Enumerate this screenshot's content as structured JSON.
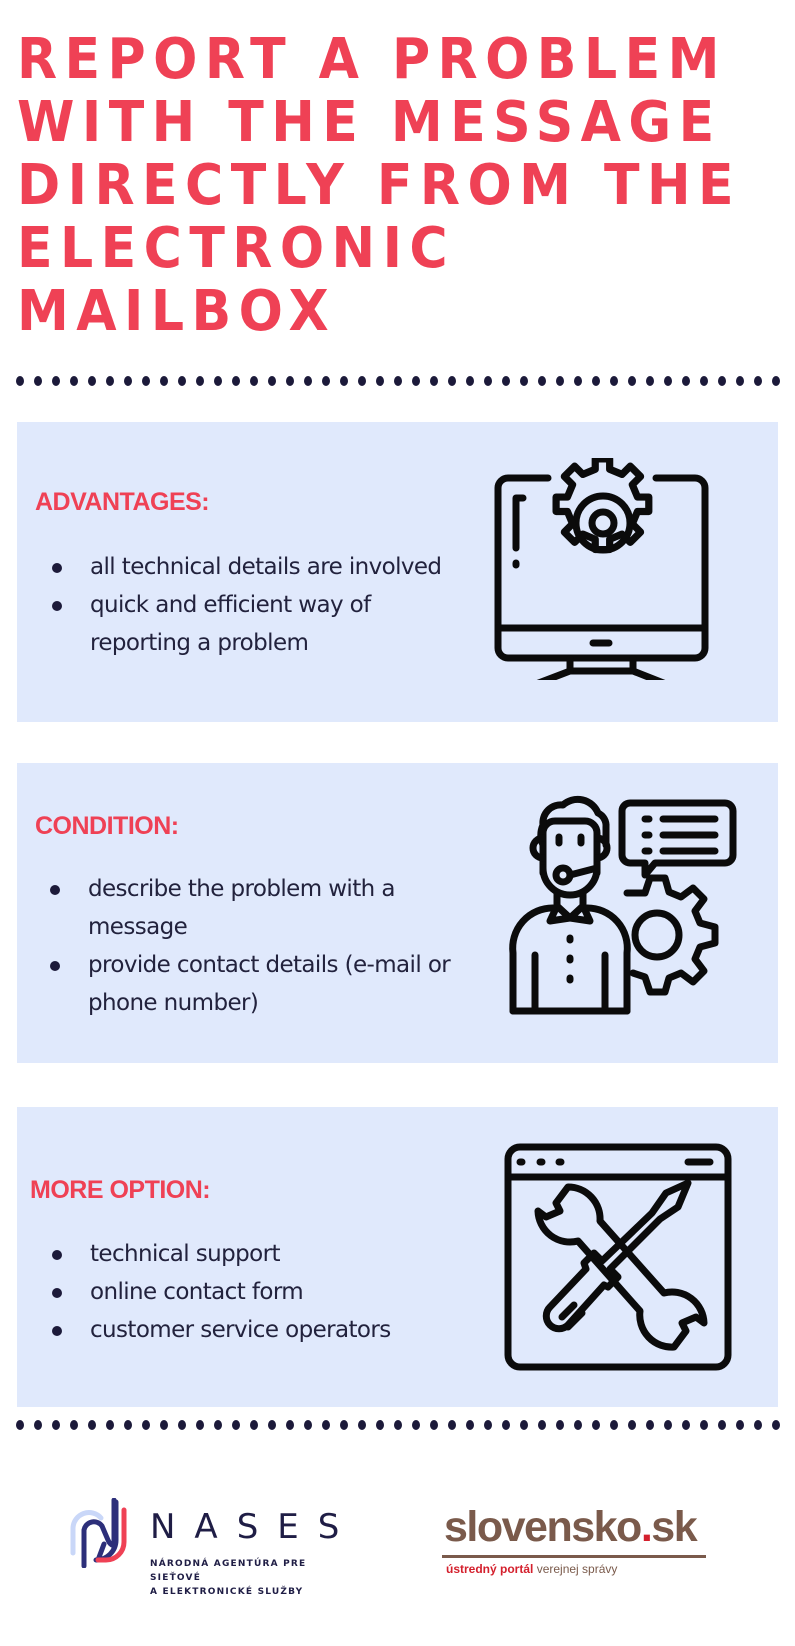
{
  "title": {
    "lines": [
      "REPORT A PROBLEM",
      "WITH THE MESSAGE",
      "DIRECTLY FROM THE",
      "ELECTRONIC",
      "MAILBOX"
    ]
  },
  "colors": {
    "accent": "#ef4155",
    "card_background": "#e0e9fc",
    "text_dark": "#22223d",
    "dots": "#1c1a3a"
  },
  "sections": [
    {
      "heading": "ADVANTAGES:",
      "icon": "monitor-gear-icon",
      "items": [
        "all technical details are involved",
        "quick and efficient way of reporting a problem"
      ]
    },
    {
      "heading": "CONDITION:",
      "icon": "support-agent-gear-icon",
      "items": [
        "describe the problem with a message",
        "provide contact details (e-mail or phone number)"
      ]
    },
    {
      "heading": "MORE OPTION:",
      "icon": "browser-tools-icon",
      "items": [
        "technical support",
        "online contact form",
        "customer service operators"
      ]
    }
  ],
  "footer": {
    "nases": {
      "name": "NASES",
      "subtitle_line1": "NÁRODNÁ AGENTÚRA PRE SIEŤOVÉ",
      "subtitle_line2": "A ELEKTRONICKÉ SLUŽBY",
      "icon": "nases-logo-icon"
    },
    "slovensko": {
      "name_main": "slovensko",
      "name_dot": ".",
      "name_tld": "sk",
      "tagline_red": "ústredný portál",
      "tagline_grey": "verejnej správy"
    }
  }
}
